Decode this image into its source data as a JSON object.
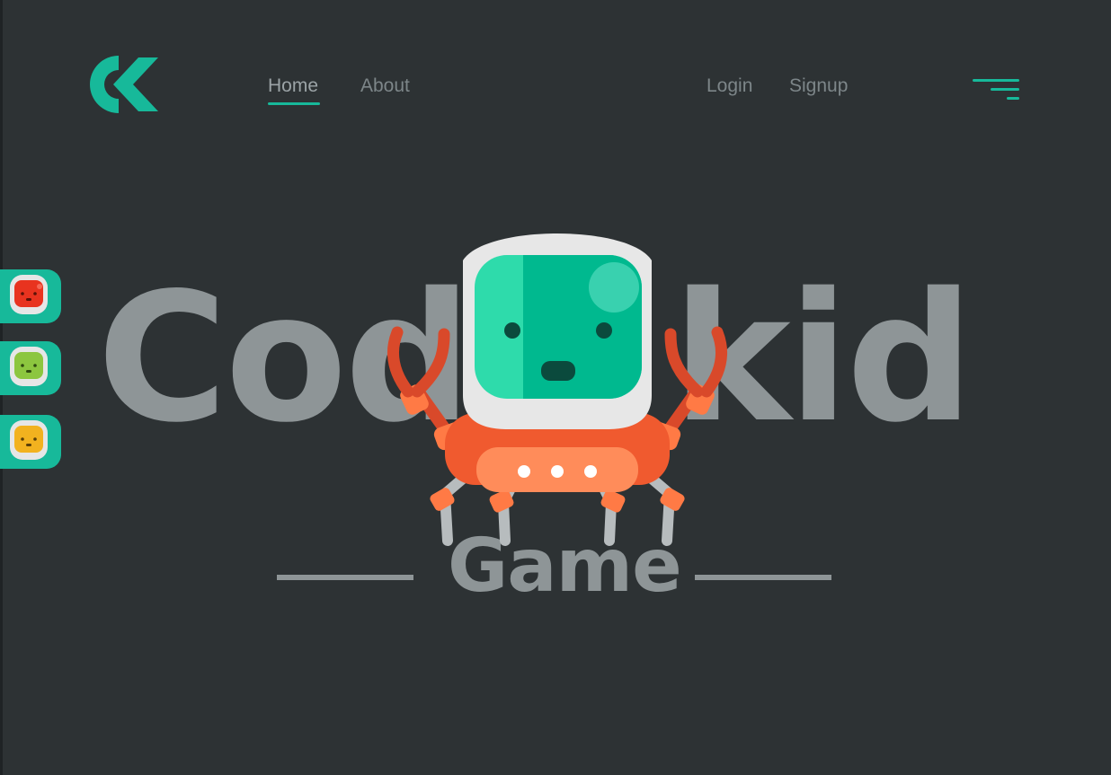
{
  "brand": {
    "logo_icon": "ck-logo-icon",
    "accent": "#17b99a"
  },
  "nav": {
    "home": "Home",
    "about": "About",
    "login": "Login",
    "signup": "Signup",
    "menu_icon": "hamburger-menu-icon"
  },
  "hero": {
    "title_left": "Codi",
    "title_right": "kid",
    "subtitle": "Game",
    "mascot_icon": "robot-crab-mascot-icon"
  },
  "characters": [
    {
      "icon": "red-robot-avatar-icon",
      "color": "#e8331f"
    },
    {
      "icon": "green-robot-avatar-icon",
      "color": "#8cc63f"
    },
    {
      "icon": "yellow-robot-avatar-icon",
      "color": "#f2b21f"
    }
  ],
  "colors": {
    "background": "#2d3234",
    "text_muted": "#8e9597"
  }
}
